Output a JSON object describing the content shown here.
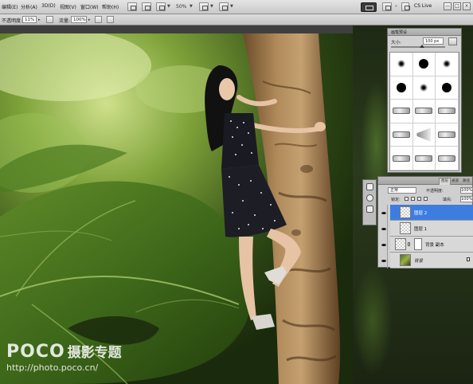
{
  "menubar": {
    "items": [
      "编辑(E)",
      "分析(A)",
      "3D(D)",
      "视图(V)",
      "窗口(W)",
      "帮助(H)"
    ],
    "zoom": "50%",
    "cs_live": "CS Live",
    "window_buttons": [
      "—",
      "□",
      "×"
    ]
  },
  "optionsbar": {
    "opacity_label": "不透明度:",
    "opacity_value": "11%",
    "flow_label": "流量:",
    "flow_value": "100%"
  },
  "brush_panel": {
    "tab": "画笔预设",
    "size_label": "大小:",
    "size_value": "100 px"
  },
  "layers_panel": {
    "tabs": [
      "图层",
      "通道",
      "路径"
    ],
    "blend_mode": "正常",
    "opacity_label": "不透明度:",
    "opacity_value": "100%",
    "lock_label": "锁定:",
    "fill_label": "填充:",
    "fill_value": "100%",
    "layers": [
      {
        "name": "图层 2",
        "selected": true
      },
      {
        "name": "图层 1",
        "selected": false
      },
      {
        "name": "背景 副本",
        "selected": false
      },
      {
        "name": "背景",
        "selected": false
      }
    ]
  },
  "watermark": {
    "brand": "POCO",
    "title": "摄影专题",
    "url": "http://photo.poco.cn/"
  }
}
